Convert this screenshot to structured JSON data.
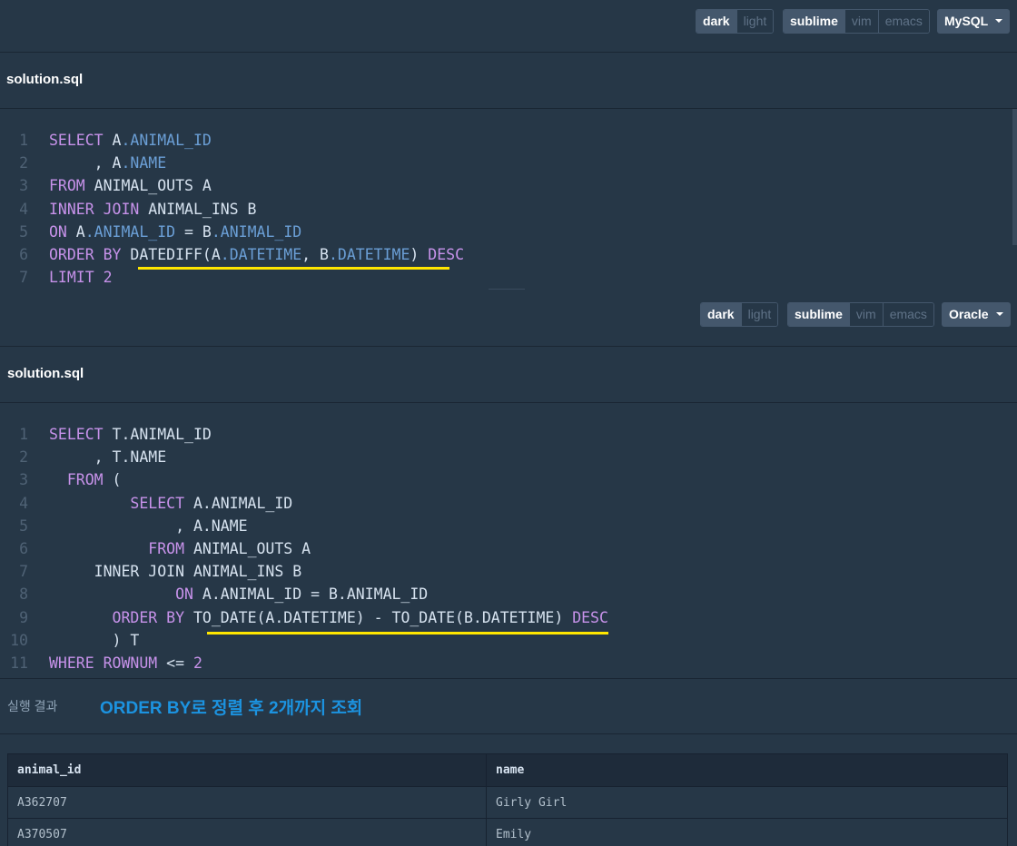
{
  "panels": [
    {
      "theme": [
        "dark",
        "light"
      ],
      "keymap": [
        "sublime",
        "vim",
        "emacs"
      ],
      "dialect": "MySQL",
      "filename": "solution.sql",
      "lines": [
        {
          "n": "1",
          "tokens": [
            {
              "t": "SELECT",
              "c": "kw"
            },
            {
              "t": " A"
            },
            {
              "t": ".ANIMAL_ID",
              "c": "prop"
            }
          ]
        },
        {
          "n": "2",
          "tokens": [
            {
              "t": "     , A"
            },
            {
              "t": ".NAME",
              "c": "prop"
            }
          ]
        },
        {
          "n": "3",
          "tokens": [
            {
              "t": "FROM",
              "c": "kw"
            },
            {
              "t": " ANIMAL_OUTS A"
            }
          ]
        },
        {
          "n": "4",
          "tokens": [
            {
              "t": "INNER JOIN",
              "c": "kw"
            },
            {
              "t": " ANIMAL_INS B"
            }
          ]
        },
        {
          "n": "5",
          "tokens": [
            {
              "t": "ON",
              "c": "kw"
            },
            {
              "t": " A"
            },
            {
              "t": ".ANIMAL_ID",
              "c": "prop"
            },
            {
              "t": " = B"
            },
            {
              "t": ".ANIMAL_ID",
              "c": "prop"
            }
          ]
        },
        {
          "n": "6",
          "tokens": [
            {
              "t": "ORDER BY",
              "c": "kw"
            },
            {
              "t": " DATEDIFF(A"
            },
            {
              "t": ".DATETIME",
              "c": "prop"
            },
            {
              "t": ", B"
            },
            {
              "t": ".DATETIME",
              "c": "prop"
            },
            {
              "t": ") "
            },
            {
              "t": "DESC",
              "c": "kw"
            }
          ]
        },
        {
          "n": "7",
          "tokens": [
            {
              "t": "LIMIT",
              "c": "kw"
            },
            {
              "t": " "
            },
            {
              "t": "2",
              "c": "num"
            }
          ]
        }
      ]
    },
    {
      "theme": [
        "dark",
        "light"
      ],
      "keymap": [
        "sublime",
        "vim",
        "emacs"
      ],
      "dialect": "Oracle",
      "filename": "solution.sql",
      "lines": [
        {
          "n": "1",
          "tokens": [
            {
              "t": "SELECT",
              "c": "kw"
            },
            {
              "t": " T.ANIMAL_ID"
            }
          ]
        },
        {
          "n": "2",
          "tokens": [
            {
              "t": "     , T.NAME"
            }
          ]
        },
        {
          "n": "3",
          "tokens": [
            {
              "t": "  "
            },
            {
              "t": "FROM",
              "c": "kw"
            },
            {
              "t": " ("
            }
          ]
        },
        {
          "n": "4",
          "tokens": [
            {
              "t": "         "
            },
            {
              "t": "SELECT",
              "c": "kw"
            },
            {
              "t": " A.ANIMAL_ID"
            }
          ]
        },
        {
          "n": "5",
          "tokens": [
            {
              "t": "              , A.NAME"
            }
          ]
        },
        {
          "n": "6",
          "tokens": [
            {
              "t": "           "
            },
            {
              "t": "FROM",
              "c": "kw"
            },
            {
              "t": " ANIMAL_OUTS A"
            }
          ]
        },
        {
          "n": "7",
          "tokens": [
            {
              "t": "     INNER JOIN ANIMAL_INS B"
            }
          ]
        },
        {
          "n": "8",
          "tokens": [
            {
              "t": "              "
            },
            {
              "t": "ON",
              "c": "kw"
            },
            {
              "t": " A.ANIMAL_ID = B.ANIMAL_ID"
            }
          ]
        },
        {
          "n": "9",
          "tokens": [
            {
              "t": "       "
            },
            {
              "t": "ORDER BY",
              "c": "kw"
            },
            {
              "t": " TO_DATE(A.DATETIME) - TO_DATE(B.DATETIME) "
            },
            {
              "t": "DESC",
              "c": "kw"
            }
          ]
        },
        {
          "n": "10",
          "tokens": [
            {
              "t": "       ) T"
            }
          ]
        },
        {
          "n": "11",
          "tokens": [
            {
              "t": "WHERE ROWNUM",
              "c": "kw"
            },
            {
              "t": " <= "
            },
            {
              "t": "2",
              "c": "num"
            }
          ]
        }
      ]
    }
  ],
  "result": {
    "label": "실행 결과",
    "note": "ORDER BY로 정렬 후 2개까지 조회",
    "columns": [
      "animal_id",
      "name"
    ],
    "rows": [
      [
        "A362707",
        "Girly Girl"
      ],
      [
        "A370507",
        "Emily"
      ]
    ]
  },
  "colors": {
    "background": "#263747",
    "keyword": "#c792ea",
    "property": "#6b9fd6",
    "highlight_underline": "#ffe600",
    "note": "#1c93e0"
  }
}
